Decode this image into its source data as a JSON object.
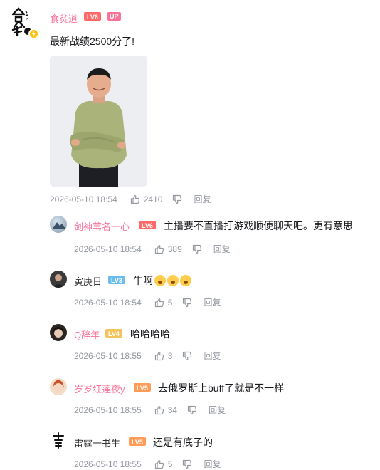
{
  "post": {
    "author": "食贫道",
    "level": "LV6",
    "up_badge": "UP",
    "text": "最新战绩2500分了!",
    "time": "2026-05-10 18:54",
    "likes": "2410",
    "reply_label": "回复"
  },
  "replies": [
    {
      "name": "剑神苇名一心",
      "level": "LV6",
      "text": "主播要不直播打游戏顺便聊天吧。更有意思",
      "time": "2026-05-10 18:54",
      "likes": "389",
      "reply_label": "回复"
    },
    {
      "name": "寅庚日",
      "level": "LV3",
      "text": "牛啊",
      "time": "2026-05-10 18:54",
      "likes": "5",
      "reply_label": "回复"
    },
    {
      "name": "Q辞年",
      "level": "LV4",
      "text": "哈哈哈哈",
      "time": "2026-05-10 18:55",
      "likes": "3",
      "reply_label": "回复"
    },
    {
      "name": "岁岁红莲夜y",
      "level": "LV5",
      "text": "去俄罗斯上buff了就是不一样",
      "time": "2026-05-10 18:55",
      "likes": "34",
      "reply_label": "回复"
    },
    {
      "name": "雷霆一书生",
      "level": "LV5",
      "text": "还是有底子的",
      "time": "2026-05-10 18:55",
      "likes": "5",
      "reply_label": "回复"
    }
  ],
  "colors": {
    "accent_pink": "#fb7299",
    "meta_gray": "#9499a0"
  }
}
